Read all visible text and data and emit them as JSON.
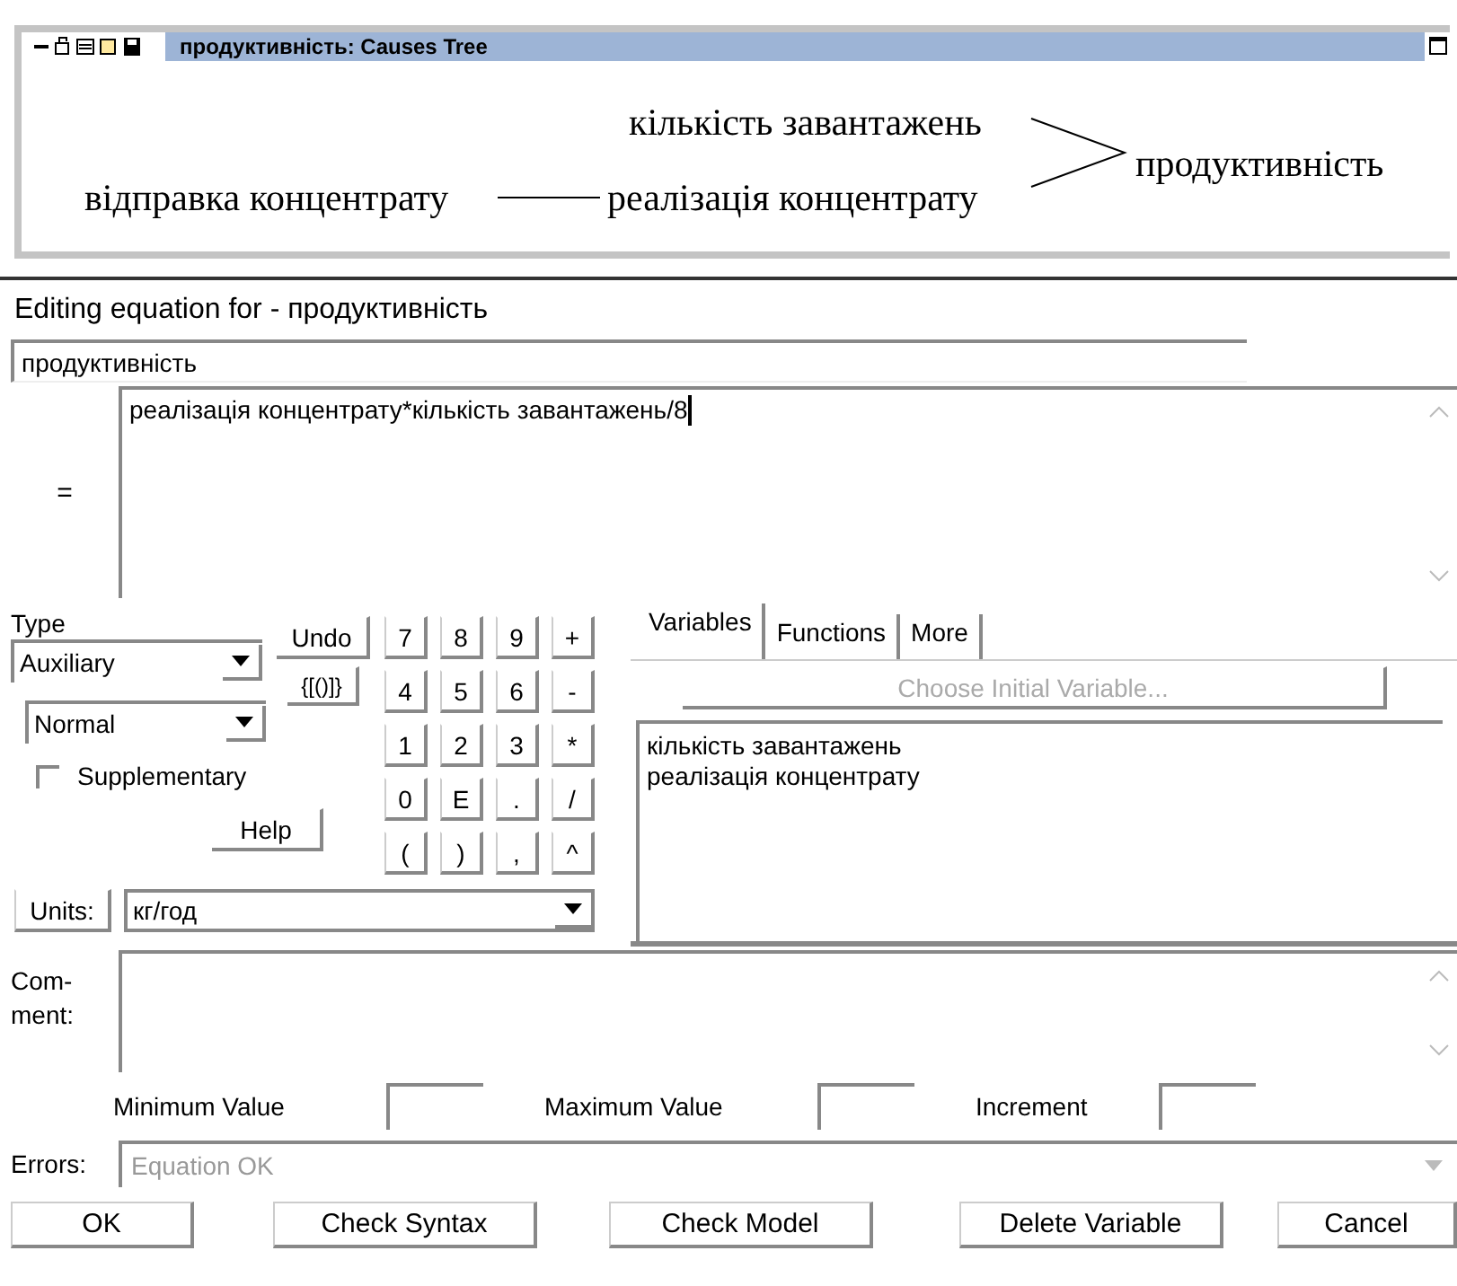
{
  "causes_tree": {
    "title": "продуктивність: Causes Tree",
    "nodes": [
      {
        "label": "кількість завантажень"
      },
      {
        "label": "продуктивність"
      },
      {
        "label": "відправка концентрату"
      },
      {
        "label": "реалізація концентрату"
      }
    ]
  },
  "dialog": {
    "title": "Editing equation for - продуктивність",
    "variable_name": "продуктивність",
    "equals_label": "=",
    "equation": "реалізація концентрату*кількість завантажень/8",
    "type_label": "Type",
    "type_value": "Auxiliary",
    "subtype_value": "Normal",
    "supplementary": {
      "label": "Supplementary",
      "checked": false
    },
    "undo": "Undo",
    "brackets": "{[()]}",
    "keys": [
      "7",
      "8",
      "9",
      "+",
      "4",
      "5",
      "6",
      "-",
      "1",
      "2",
      "3",
      "*",
      "0",
      "E",
      ".",
      "/",
      "(",
      ")",
      ",",
      "^"
    ],
    "help": "Help",
    "units_button": "Units:",
    "units_value": "кг/год",
    "tabs": [
      {
        "label": "Variables",
        "selected": true
      },
      {
        "label": "Functions",
        "selected": false
      },
      {
        "label": "More",
        "selected": false
      }
    ],
    "choose_initial": {
      "label": "Choose Initial Variable...",
      "disabled": true
    },
    "variables": [
      "кількість завантажень",
      "реалізація концентрату"
    ],
    "comment_label": "Com-\nment:",
    "min_label": "Minimum Value",
    "max_label": "Maximum Value",
    "increment_label": "Increment",
    "errors_label": "Errors:",
    "errors_value": "Equation OK",
    "buttons": [
      "OK",
      "Check Syntax",
      "Check Model",
      "Delete Variable",
      "Cancel"
    ]
  }
}
